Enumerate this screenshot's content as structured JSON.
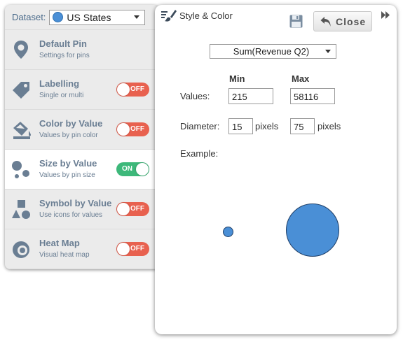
{
  "dataset": {
    "label": "Dataset:",
    "selected": "US States",
    "dot_color": "#4a8fd6"
  },
  "menu": {
    "items": [
      {
        "title": "Default Pin",
        "subtitle": "Settings for pins",
        "icon": "map-pin-icon"
      },
      {
        "title": "Labelling",
        "subtitle": "Single or multi",
        "icon": "tag-icon",
        "toggle": "OFF"
      },
      {
        "title": "Color by Value",
        "subtitle": "Values by pin color",
        "icon": "paint-bucket-icon",
        "toggle": "OFF"
      },
      {
        "title": "Size by Value",
        "subtitle": "Values by pin size",
        "icon": "circles-size-icon",
        "toggle": "ON",
        "active": true
      },
      {
        "title": "Symbol by Value",
        "subtitle": "Use icons for values",
        "icon": "shapes-icon",
        "toggle": "OFF"
      },
      {
        "title": "Heat Map",
        "subtitle": "Visual heat map",
        "icon": "heatmap-icon",
        "toggle": "OFF"
      }
    ]
  },
  "panel": {
    "title": "Style & Color",
    "close_label": "Close",
    "metric": "Sum(Revenue Q2)",
    "min_header": "Min",
    "max_header": "Max",
    "values_label": "Values:",
    "min_value": "215",
    "max_value": "58116",
    "diameter_label": "Diameter:",
    "min_diameter": "15",
    "max_diameter": "75",
    "unit": "pixels",
    "example_label": "Example:"
  },
  "colors": {
    "accent": "#4a8fd6",
    "toggle_off": "#e8614f",
    "toggle_on": "#3db87a",
    "menu_text": "#6a7e93"
  }
}
